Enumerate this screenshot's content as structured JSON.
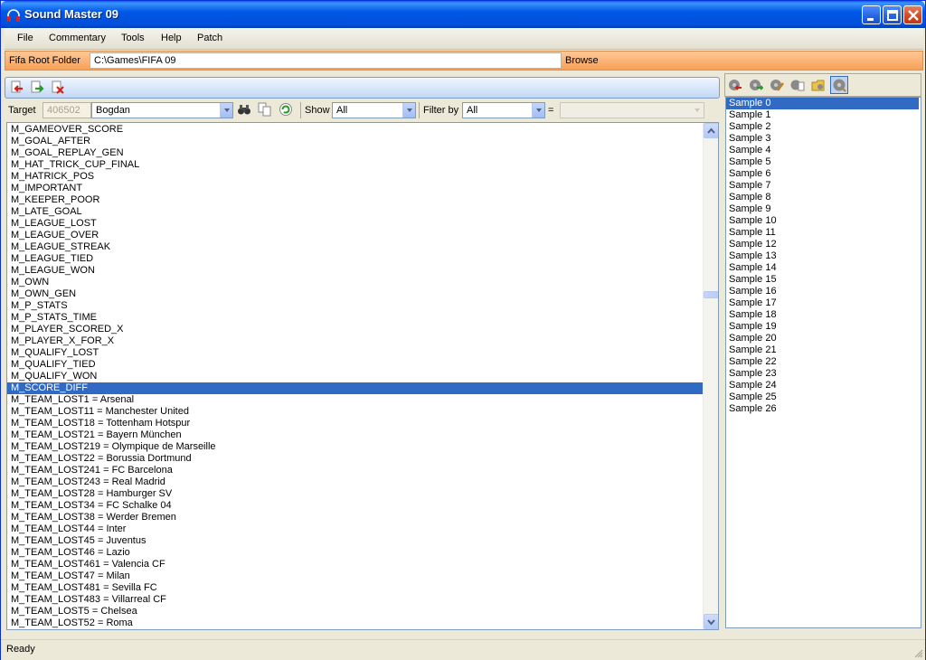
{
  "window": {
    "title": "Sound Master 09"
  },
  "menu": [
    "File",
    "Commentary",
    "Tools",
    "Help",
    "Patch"
  ],
  "root": {
    "label": "Fifa Root Folder",
    "value": "C:\\Games\\FIFA 09",
    "browse": "Browse"
  },
  "filters": {
    "target_label": "Target",
    "target_id": "406502",
    "target_name": "Bogdan",
    "show_label": "Show",
    "show_value": "All",
    "filter_label": "Filter by",
    "filter_value": "All",
    "equals": "=",
    "equals_value": ""
  },
  "events": [
    "M_GAMEOVER_SCORE",
    "M_GOAL_AFTER",
    "M_GOAL_REPLAY_GEN",
    "M_HAT_TRICK_CUP_FINAL",
    "M_HATRICK_POS",
    "M_IMPORTANT",
    "M_KEEPER_POOR",
    "M_LATE_GOAL",
    "M_LEAGUE_LOST",
    "M_LEAGUE_OVER",
    "M_LEAGUE_STREAK",
    "M_LEAGUE_TIED",
    "M_LEAGUE_WON",
    "M_OWN",
    "M_OWN_GEN",
    "M_P_STATS",
    "M_P_STATS_TIME",
    "M_PLAYER_SCORED_X",
    "M_PLAYER_X_FOR_X",
    "M_QUALIFY_LOST",
    "M_QUALIFY_TIED",
    "M_QUALIFY_WON",
    "M_SCORE_DIFF",
    "M_TEAM_LOST1 = Arsenal",
    "M_TEAM_LOST11 = Manchester United",
    "M_TEAM_LOST18 = Tottenham Hotspur",
    "M_TEAM_LOST21 = Bayern München",
    "M_TEAM_LOST219 = Olympique de Marseille",
    "M_TEAM_LOST22 = Borussia Dortmund",
    "M_TEAM_LOST241 = FC Barcelona",
    "M_TEAM_LOST243 = Real Madrid",
    "M_TEAM_LOST28 = Hamburger SV",
    "M_TEAM_LOST34 = FC Schalke 04",
    "M_TEAM_LOST38 = Werder Bremen",
    "M_TEAM_LOST44 = Inter",
    "M_TEAM_LOST45 = Juventus",
    "M_TEAM_LOST46 = Lazio",
    "M_TEAM_LOST461 = Valencia CF",
    "M_TEAM_LOST47 = Milan",
    "M_TEAM_LOST481 = Sevilla FC",
    "M_TEAM_LOST483 = Villarreal CF",
    "M_TEAM_LOST5 = Chelsea",
    "M_TEAM_LOST52 = Roma"
  ],
  "selected_event": "M_SCORE_DIFF",
  "samples": [
    "Sample 0",
    "Sample 1",
    "Sample 2",
    "Sample 3",
    "Sample 4",
    "Sample 5",
    "Sample 6",
    "Sample 7",
    "Sample 8",
    "Sample 9",
    "Sample 10",
    "Sample 11",
    "Sample 12",
    "Sample 13",
    "Sample 14",
    "Sample 15",
    "Sample 16",
    "Sample 17",
    "Sample 18",
    "Sample 19",
    "Sample 20",
    "Sample 21",
    "Sample 22",
    "Sample 23",
    "Sample 24",
    "Sample 25",
    "Sample 26"
  ],
  "selected_sample": "Sample 0",
  "status": {
    "text": "Ready"
  },
  "colors": {
    "selection": "#316ac5",
    "title_bar": "#0058e6",
    "root_bar": "#f7a058"
  },
  "icons": {
    "left_toolbar": [
      "import-icon",
      "export-icon",
      "delete-icon"
    ],
    "filter_tools": [
      "binoculars-icon",
      "copy-icon",
      "refresh-icon"
    ],
    "right_toolbar": [
      "import-sample-icon",
      "export-sample-icon",
      "edit-sample-icon",
      "copy-sample-icon",
      "folder-sample-icon",
      "play-sample-icon"
    ]
  }
}
